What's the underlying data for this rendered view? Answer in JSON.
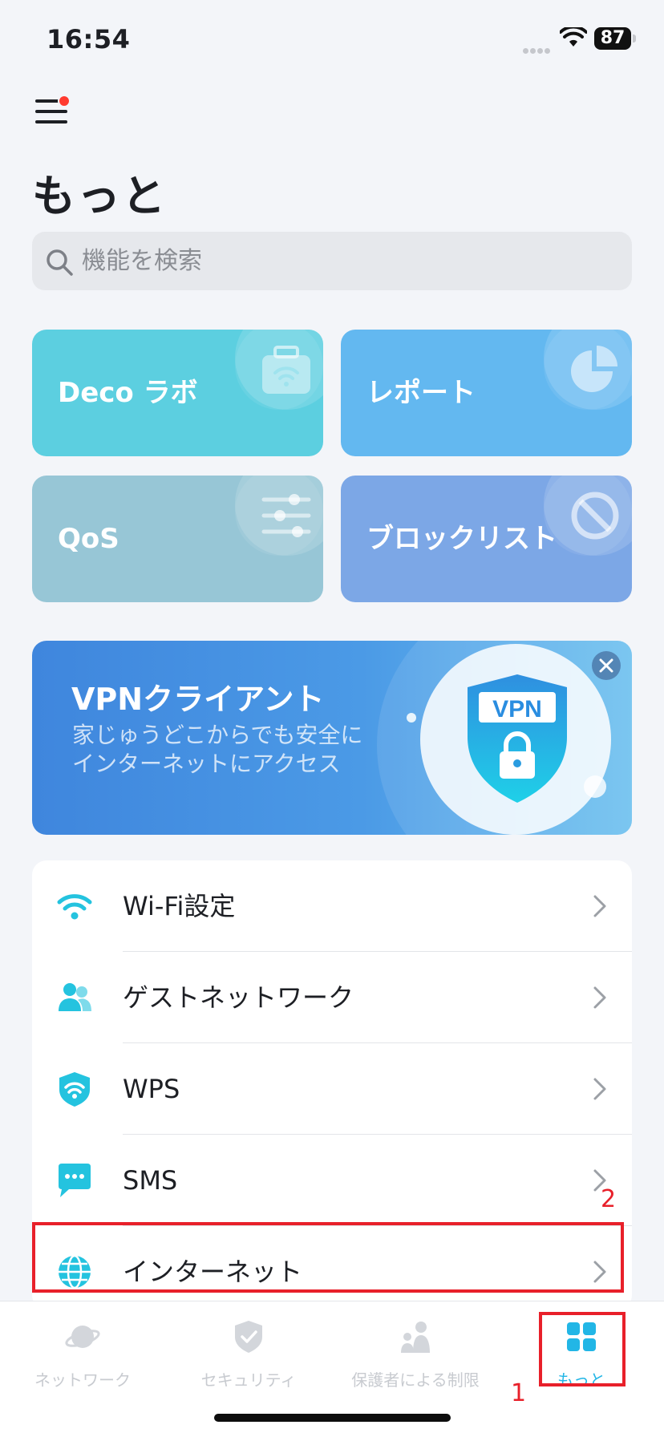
{
  "status_bar": {
    "time": "16:54",
    "battery": "87"
  },
  "header": {
    "title": "もっと"
  },
  "search": {
    "placeholder": "機能を検索"
  },
  "tiles": [
    {
      "label": "Deco ラボ",
      "icon": "toolbox-wifi-icon",
      "color": "#5ccfe0"
    },
    {
      "label": "レポート",
      "icon": "pie-chart-icon",
      "color": "#63b8f0"
    },
    {
      "label": "QoS",
      "icon": "sliders-icon",
      "color": "#97c6d6"
    },
    {
      "label": "ブロックリスト",
      "icon": "block-icon",
      "color": "#7ca7e6"
    }
  ],
  "vpn_banner": {
    "title": "VPNクライアント",
    "description": "家じゅうどこからでも安全にインターネットにアクセス",
    "badge": "VPN"
  },
  "settings_list": [
    {
      "label": "Wi-Fi設定",
      "icon": "wifi-icon"
    },
    {
      "label": "ゲストネットワーク",
      "icon": "users-icon"
    },
    {
      "label": "WPS",
      "icon": "wps-shield-icon"
    },
    {
      "label": "SMS",
      "icon": "message-icon"
    },
    {
      "label": "インターネット",
      "icon": "globe-icon"
    }
  ],
  "annotations": {
    "step1": "1",
    "step2": "2"
  },
  "tab_bar": [
    {
      "label": "ネットワーク",
      "icon": "planet-icon",
      "active": false
    },
    {
      "label": "セキュリティ",
      "icon": "shield-check-icon",
      "active": false
    },
    {
      "label": "保護者による制限",
      "icon": "family-icon",
      "active": false
    },
    {
      "label": "もっと",
      "icon": "grid-icon",
      "active": true
    }
  ],
  "colors": {
    "accent": "#22b6e6",
    "annotation": "#e8202a",
    "badge": "#ff3b30"
  }
}
